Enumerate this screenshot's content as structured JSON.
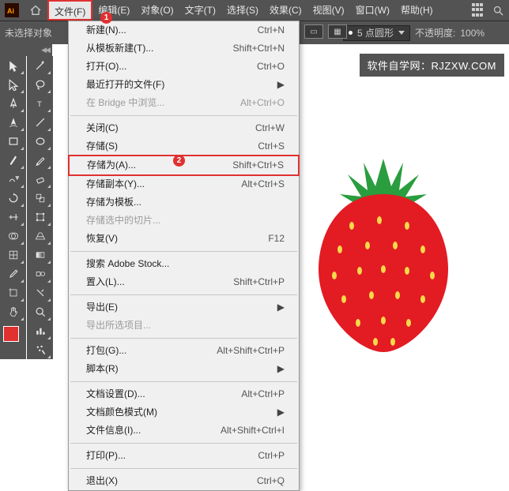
{
  "menubar": {
    "items": [
      "文件(F)",
      "编辑(E)",
      "对象(O)",
      "文字(T)",
      "选择(S)",
      "效果(C)",
      "视图(V)",
      "窗口(W)",
      "帮助(H)"
    ],
    "active_index": 0
  },
  "optbar": {
    "no_selection": "未选择对象",
    "stroke_label": "5 点圆形",
    "opacity_label": "不透明度:",
    "opacity_value": "100%"
  },
  "watermark": "软件自学网：RJZXW.COM",
  "badges": {
    "b1": "1",
    "b2": "2"
  },
  "dropdown": {
    "groups": [
      [
        {
          "label": "新建(N)...",
          "shortcut": "Ctrl+N",
          "enabled": true
        },
        {
          "label": "从模板新建(T)...",
          "shortcut": "Shift+Ctrl+N",
          "enabled": true
        },
        {
          "label": "打开(O)...",
          "shortcut": "Ctrl+O",
          "enabled": true
        },
        {
          "label": "最近打开的文件(F)",
          "shortcut": "",
          "enabled": true,
          "submenu": true
        },
        {
          "label": "在 Bridge 中浏览...",
          "shortcut": "Alt+Ctrl+O",
          "enabled": false
        }
      ],
      [
        {
          "label": "关闭(C)",
          "shortcut": "Ctrl+W",
          "enabled": true
        },
        {
          "label": "存储(S)",
          "shortcut": "Ctrl+S",
          "enabled": true
        },
        {
          "label": "存储为(A)...",
          "shortcut": "Shift+Ctrl+S",
          "enabled": true,
          "highlight": true
        },
        {
          "label": "存储副本(Y)...",
          "shortcut": "Alt+Ctrl+S",
          "enabled": true
        },
        {
          "label": "存储为模板...",
          "shortcut": "",
          "enabled": true
        },
        {
          "label": "存储选中的切片...",
          "shortcut": "",
          "enabled": false
        },
        {
          "label": "恢复(V)",
          "shortcut": "F12",
          "enabled": true
        }
      ],
      [
        {
          "label": "搜索 Adobe Stock...",
          "shortcut": "",
          "enabled": true
        },
        {
          "label": "置入(L)...",
          "shortcut": "Shift+Ctrl+P",
          "enabled": true
        }
      ],
      [
        {
          "label": "导出(E)",
          "shortcut": "",
          "enabled": true,
          "submenu": true
        },
        {
          "label": "导出所选项目...",
          "shortcut": "",
          "enabled": false
        }
      ],
      [
        {
          "label": "打包(G)...",
          "shortcut": "Alt+Shift+Ctrl+P",
          "enabled": true
        },
        {
          "label": "脚本(R)",
          "shortcut": "",
          "enabled": true,
          "submenu": true
        }
      ],
      [
        {
          "label": "文档设置(D)...",
          "shortcut": "Alt+Ctrl+P",
          "enabled": true
        },
        {
          "label": "文档颜色模式(M)",
          "shortcut": "",
          "enabled": true,
          "submenu": true
        },
        {
          "label": "文件信息(I)...",
          "shortcut": "Alt+Shift+Ctrl+I",
          "enabled": true
        }
      ],
      [
        {
          "label": "打印(P)...",
          "shortcut": "Ctrl+P",
          "enabled": true
        }
      ],
      [
        {
          "label": "退出(X)",
          "shortcut": "Ctrl+Q",
          "enabled": true
        }
      ]
    ]
  },
  "tools_left": [
    "selection",
    "direct-select",
    "pen",
    "curvature",
    "rectangle",
    "paintbrush",
    "shaper",
    "rotate",
    "width",
    "shape-builder",
    "mesh",
    "eyedropper",
    "artboard",
    "hand"
  ],
  "tools_right": [
    "magic-wand",
    "lasso",
    "type",
    "line",
    "ellipse",
    "pencil",
    "eraser",
    "scale",
    "free-transform",
    "perspective",
    "gradient",
    "blend",
    "slice",
    "zoom",
    "column-graph",
    "symbol-sprayer"
  ]
}
